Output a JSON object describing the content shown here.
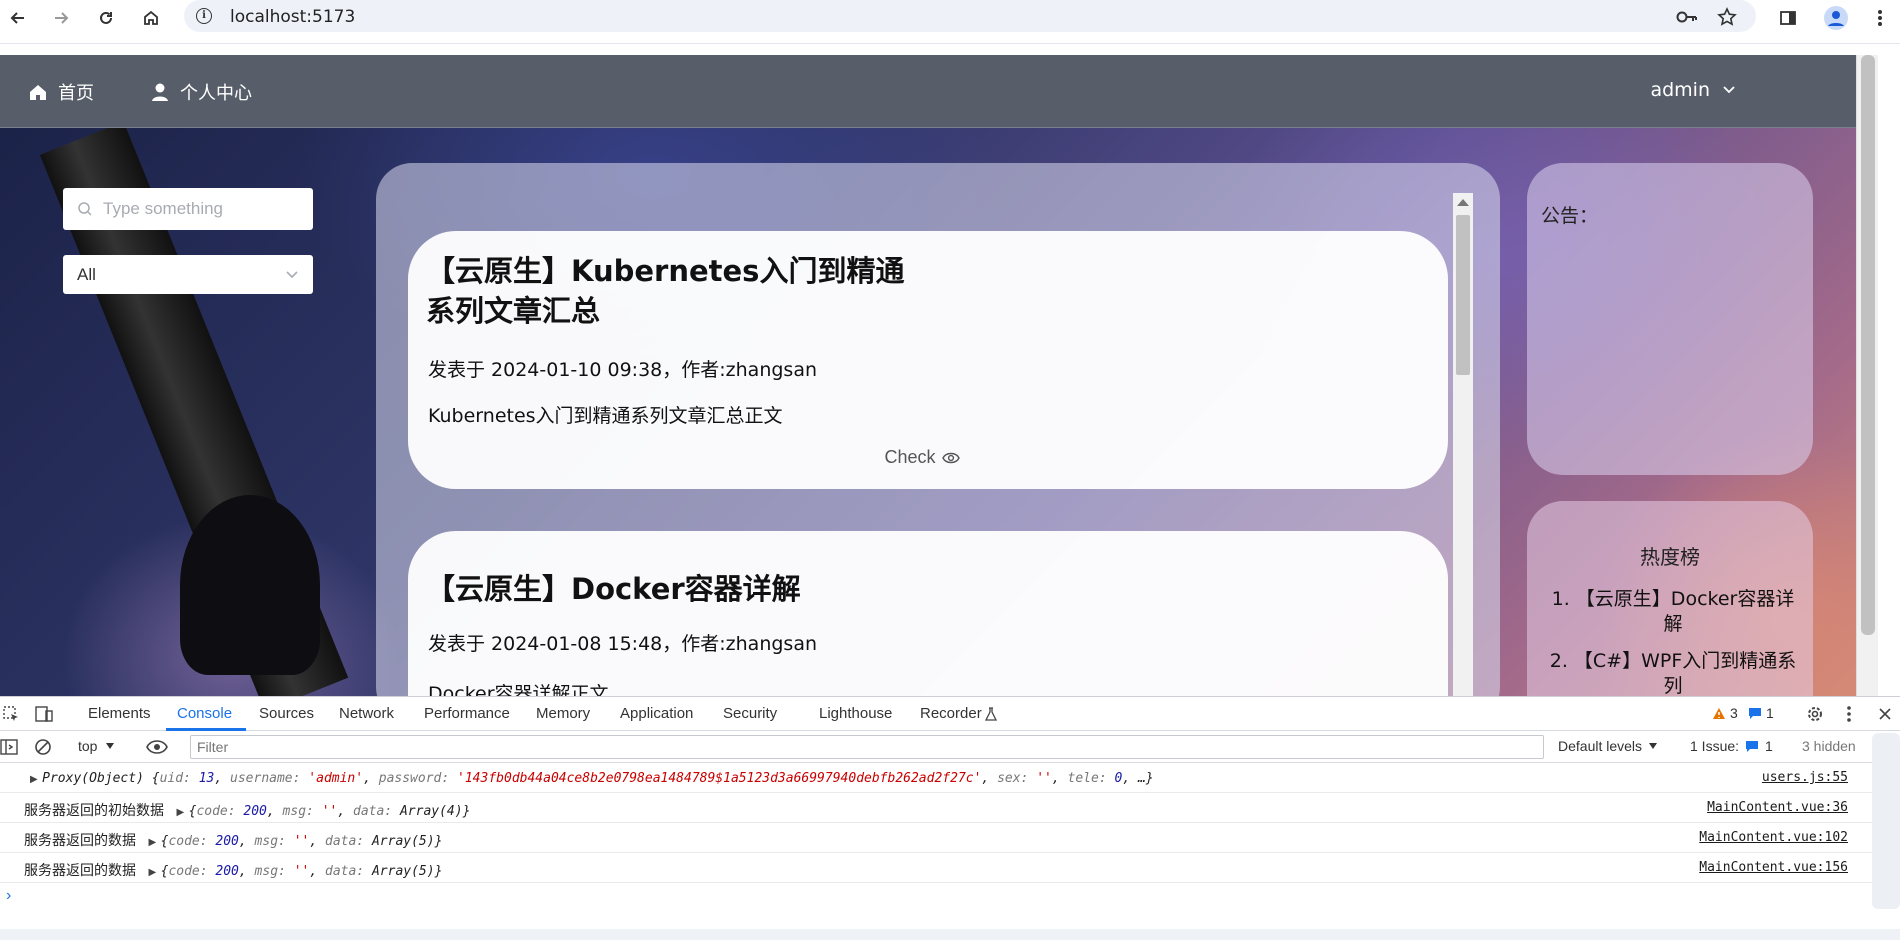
{
  "browser": {
    "url": "localhost:5173"
  },
  "header": {
    "nav": [
      {
        "label": "首页",
        "icon": "home-icon"
      },
      {
        "label": "个人中心",
        "icon": "user-icon"
      }
    ],
    "user": "admin"
  },
  "filters": {
    "search_placeholder": "Type something",
    "category_value": "All"
  },
  "articles": [
    {
      "title": "【云原生】Kubernetes入门到精通系列文章汇总",
      "meta": "发表于 2024-01-10 09:38，作者:zhangsan",
      "body": "Kubernetes入门到精通系列文章汇总正文",
      "check_label": "Check"
    },
    {
      "title": "【云原生】Docker容器详解",
      "meta": "发表于 2024-01-08 15:48，作者:zhangsan",
      "body": "Docker容器详解正文"
    }
  ],
  "sidebar": {
    "notice_title": "公告：",
    "hot_title": "热度榜",
    "hot_items": [
      "1. 【云原生】Docker容器详解",
      "2. 【C#】WPF入门到精通系列"
    ]
  },
  "devtools": {
    "tabs": [
      "Elements",
      "Console",
      "Sources",
      "Network",
      "Performance",
      "Memory",
      "Application",
      "Security",
      "Lighthouse",
      "Recorder"
    ],
    "active_tab": "Console",
    "warnings": "3",
    "messages": "1",
    "context": "top",
    "filter_placeholder": "Filter",
    "levels": "Default levels",
    "issues_label": "1 Issue:",
    "issues_count": "1",
    "hidden": "3 hidden",
    "lines": [
      {
        "source": "users.js:55"
      },
      {
        "text": "服务器返回的初始数据",
        "source": "MainContent.vue:36"
      },
      {
        "text": "服务器返回的数据",
        "source": "MainContent.vue:102"
      },
      {
        "text": "服务器返回的数据",
        "source": "MainContent.vue:156"
      }
    ],
    "proxy": {
      "uid": "13",
      "username": "'admin'",
      "password": "'143fb0db44a04ce8b2e0798ea1484789$1a5123d3a66997940debfb262ad2f27c'",
      "sex": "''",
      "tele": "0"
    },
    "data_initial": {
      "code": "200",
      "msg": "''",
      "data": "Array(4)"
    },
    "data_next": {
      "code": "200",
      "msg": "''",
      "data": "Array(5)"
    }
  }
}
